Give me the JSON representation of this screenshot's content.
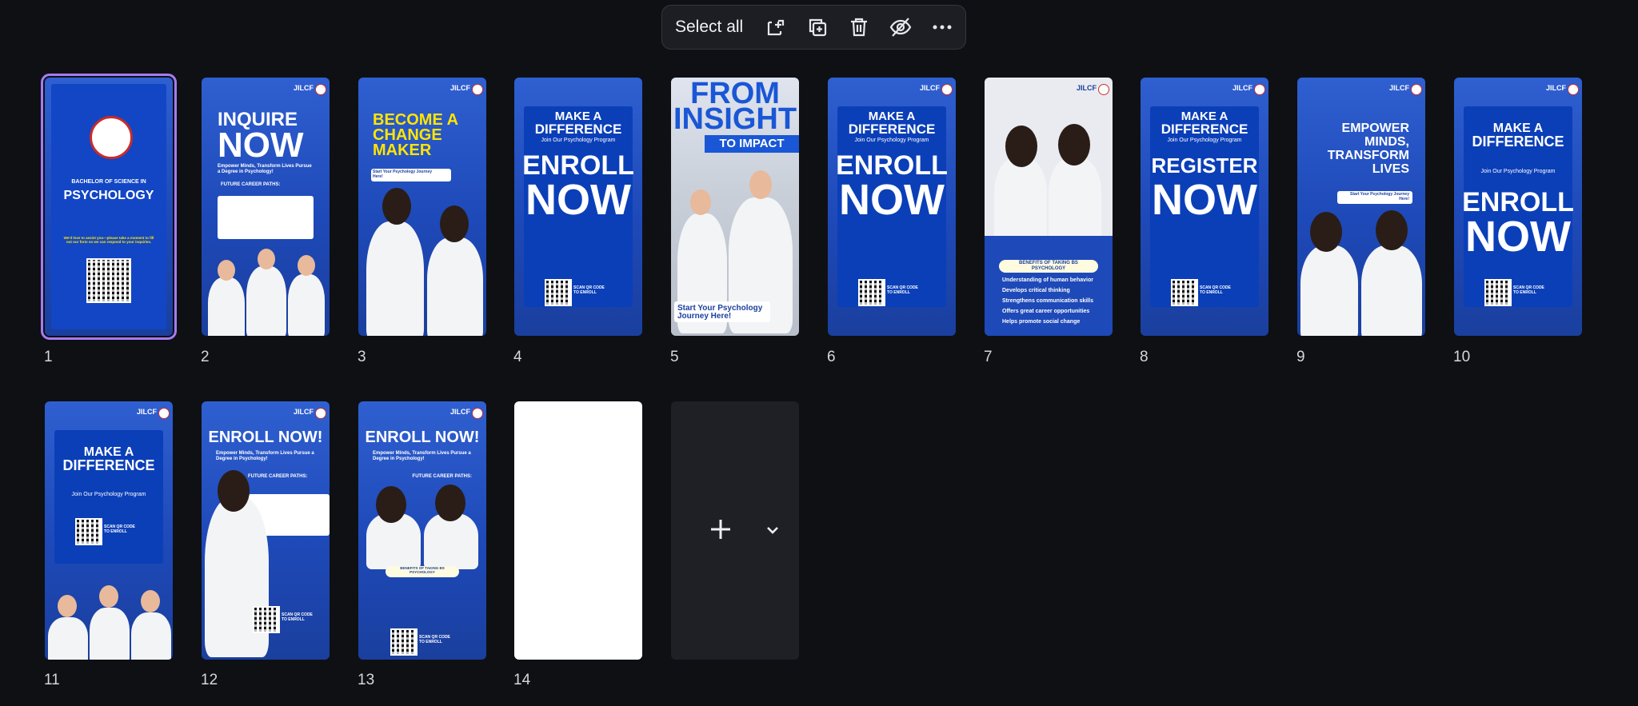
{
  "toolbar": {
    "select_all_label": "Select all",
    "icons": [
      "add-page-icon",
      "duplicate-icon",
      "trash-icon",
      "hide-icon",
      "more-icon"
    ]
  },
  "pages": [
    {
      "number": "1",
      "selected": true,
      "texts": {
        "line1": "BACHELOR OF SCIENCE IN",
        "line2": "PSYCHOLOGY",
        "note": "We'd love to assist you—please take a moment to fill out our form so we can respond to your inquiries."
      }
    },
    {
      "number": "2",
      "texts": {
        "line1": "INQUIRE",
        "line2": "NOW",
        "sub": "Empower Minds, Transform Lives Pursue a Degree in Psychology!",
        "paths": "FUTURE CAREER PATHS:",
        "brand": "JILCF"
      }
    },
    {
      "number": "3",
      "texts": {
        "line1": "BECOME A",
        "line2": "CHANGE",
        "line3": "MAKER",
        "sub": "Start Your Psychology Journey Here!",
        "brand": "JILCF"
      }
    },
    {
      "number": "4",
      "texts": {
        "line1": "MAKE A",
        "line2": "DIFFERENCE",
        "sub": "Join Our Psychology Program",
        "big1": "ENROLL",
        "big2": "NOW",
        "scan": "SCAN QR CODE TO ENROLL",
        "brand": "JILCF"
      }
    },
    {
      "number": "5",
      "texts": {
        "line1": "FROM",
        "line2": "INSIGHT",
        "line3": "TO IMPACT",
        "sub": "Start Your Psychology Journey Here!"
      }
    },
    {
      "number": "6",
      "texts": {
        "line1": "MAKE A",
        "line2": "DIFFERENCE",
        "sub": "Join Our Psychology Program",
        "big1": "ENROLL",
        "big2": "NOW",
        "scan": "SCAN QR CODE TO ENROLL",
        "brand": "JILCF"
      }
    },
    {
      "number": "7",
      "texts": {
        "title": "BENEFITS OF TAKING BS PSYCHOLOGY",
        "b1": "Understanding of human behavior",
        "b2": "Develops critical thinking",
        "b3": "Strengthens communication skills",
        "b4": "Offers great career opportunities",
        "b5": "Helps promote social change",
        "brand": "JILCF"
      }
    },
    {
      "number": "8",
      "texts": {
        "line1": "MAKE A",
        "line2": "DIFFERENCE",
        "sub": "Join Our Psychology Program",
        "big1": "REGISTER",
        "big2": "NOW",
        "scan": "SCAN QR CODE TO ENROLL",
        "brand": "JILCF"
      }
    },
    {
      "number": "9",
      "texts": {
        "line1": "EMPOWER",
        "line2": "MINDS,",
        "line3": "TRANSFORM",
        "line4": "LIVES",
        "sub": "Start Your Psychology Journey Here!",
        "brand": "JILCF"
      }
    },
    {
      "number": "10",
      "texts": {
        "line1": "MAKE A",
        "line2": "DIFFERENCE",
        "sub": "Join Our Psychology Program",
        "big1": "ENROLL",
        "big2": "NOW",
        "scan": "SCAN QR CODE TO ENROLL",
        "brand": "JILCF"
      }
    },
    {
      "number": "11",
      "texts": {
        "line1": "MAKE A",
        "line2": "DIFFERENCE",
        "sub": "Join Our Psychology Program",
        "scan": "SCAN QR CODE TO ENROLL",
        "brand": "JILCF"
      }
    },
    {
      "number": "12",
      "texts": {
        "line1": "ENROLL NOW!",
        "sub": "Empower Minds, Transform Lives Pursue a Degree in Psychology!",
        "paths": "FUTURE CAREER PATHS:",
        "scan": "SCAN QR CODE TO ENROLL",
        "brand": "JILCF"
      }
    },
    {
      "number": "13",
      "texts": {
        "line1": "ENROLL NOW!",
        "sub": "Empower Minds, Transform Lives Pursue a Degree in Psychology!",
        "paths": "FUTURE CAREER PATHS:",
        "title": "BENEFITS OF TAKING BS PSYCHOLOGY",
        "scan": "SCAN QR CODE TO ENROLL",
        "brand": "JILCF"
      }
    },
    {
      "number": "14",
      "texts": {}
    }
  ],
  "add_page": {
    "icons": [
      "plus-icon",
      "chevron-down-icon"
    ]
  }
}
